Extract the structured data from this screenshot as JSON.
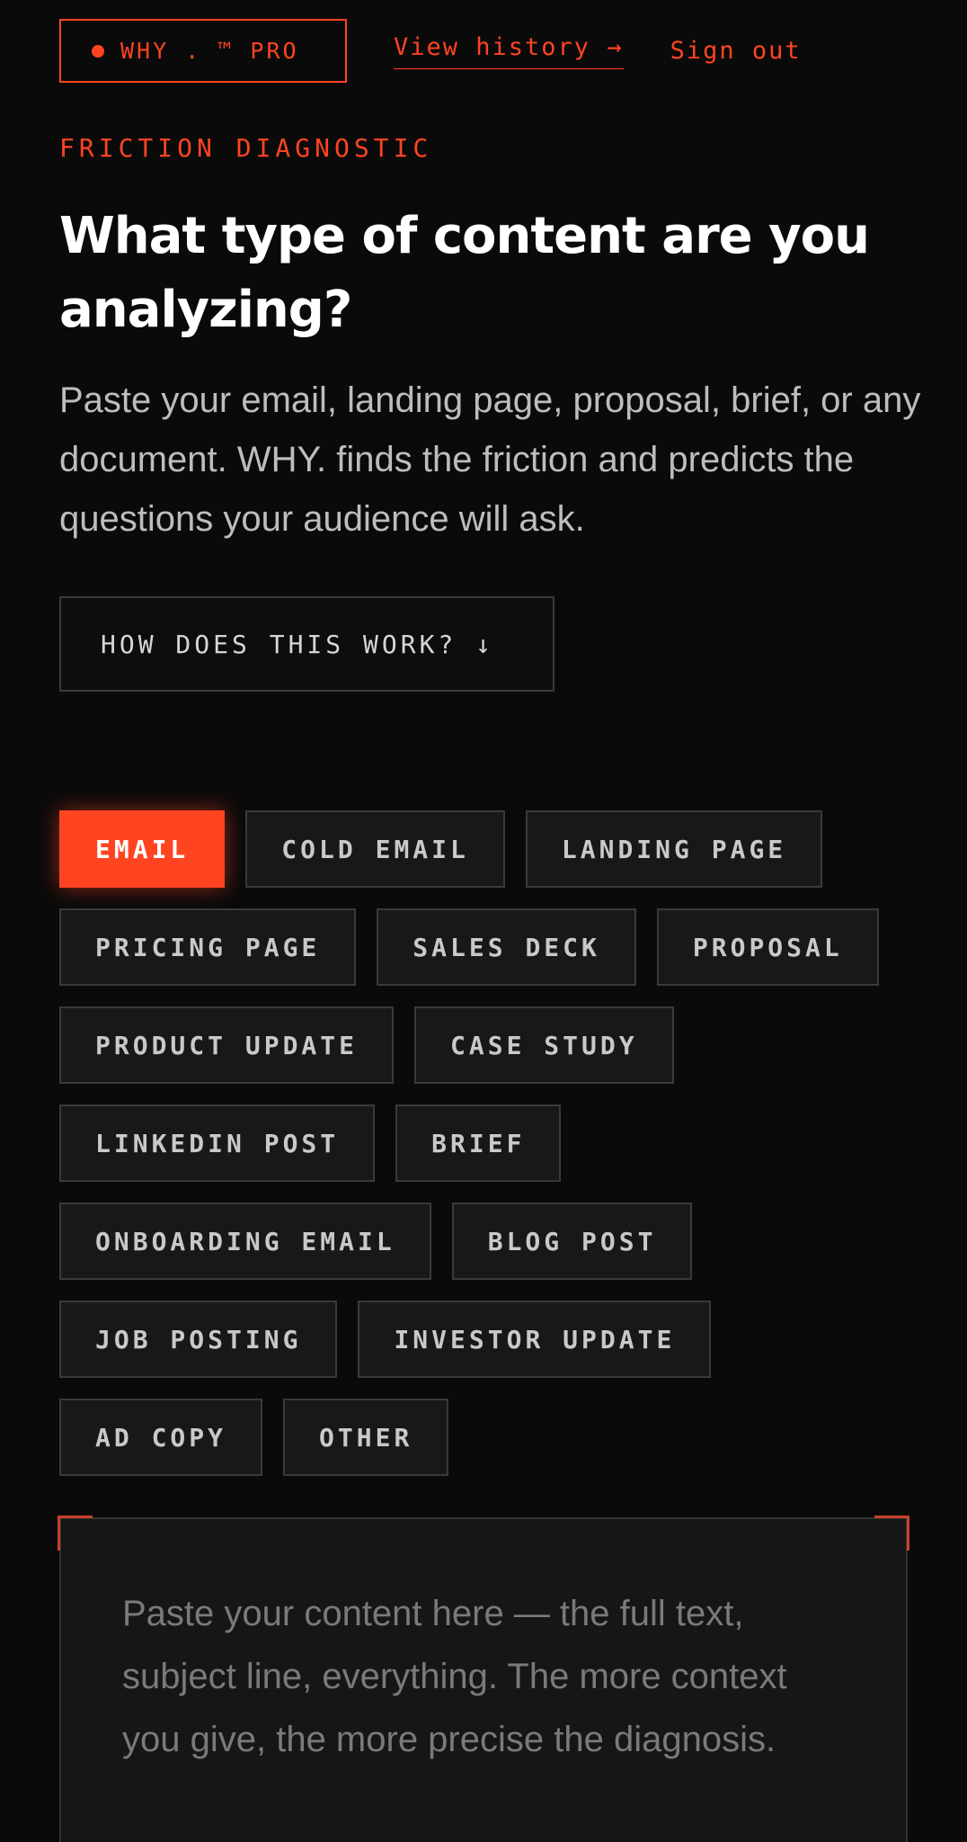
{
  "header": {
    "brand_label": "WHY . ™ PRO",
    "history_link": "View history →",
    "signout_link": "Sign out"
  },
  "eyebrow": "FRICTION DIAGNOSTIC",
  "title": "What type of content are you analyzing?",
  "intro": "Paste your email, landing page, proposal, brief, or any document. WHY. finds the friction and predicts the questions your audience will ask.",
  "how_button": "HOW DOES THIS WORK? ↓",
  "chips": [
    [
      "EMAIL",
      "COLD EMAIL",
      "LANDING PAGE"
    ],
    [
      "PRICING PAGE",
      "SALES DECK",
      "PROPOSAL"
    ],
    [
      "PRODUCT UPDATE",
      "CASE STUDY"
    ],
    [
      "LINKEDIN POST",
      "BRIEF"
    ],
    [
      "ONBOARDING EMAIL",
      "BLOG POST"
    ],
    [
      "JOB POSTING",
      "INVESTOR UPDATE"
    ],
    [
      "AD COPY",
      "OTHER"
    ]
  ],
  "selected_chip": "EMAIL",
  "content_input": {
    "value": "",
    "placeholder": "Paste your content here — the full text, subject line, everything. The more context you give, the more precise the diagnosis."
  },
  "colors": {
    "accent": "#ff4422",
    "background": "#0a0a0a",
    "chip_background": "#181818",
    "border": "#3a3a3a"
  }
}
